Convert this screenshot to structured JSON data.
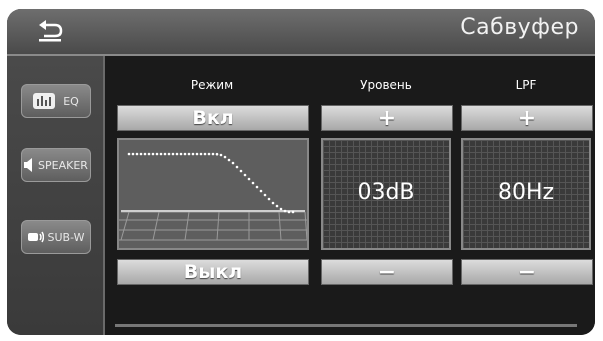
{
  "title": "Сабвуфер",
  "sidebar": {
    "items": [
      {
        "label": "EQ",
        "icon": "eq-icon"
      },
      {
        "label": "SPEAKER",
        "icon": "speaker-icon"
      },
      {
        "label": "SUB-W",
        "icon": "subwoofer-icon"
      }
    ]
  },
  "columns": {
    "mode": {
      "header": "Режим",
      "on_label": "Вкл",
      "off_label": "Выкл"
    },
    "level": {
      "header": "Уровень",
      "plus": "+",
      "minus": "−",
      "value": "03dB"
    },
    "lpf": {
      "header": "LPF",
      "plus": "+",
      "minus": "−",
      "value": "80Hz"
    }
  }
}
